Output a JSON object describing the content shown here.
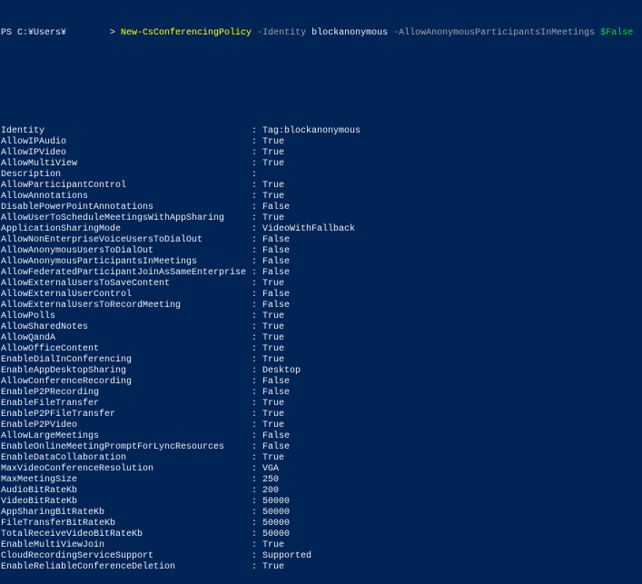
{
  "prompt": {
    "text": "PS C:¥Users¥        > ",
    "command": "New-CsConferencingPolicy",
    "param1": "-Identity",
    "arg1": "blockanonymous",
    "param2": "-AllowAnonymousParticipantsInMeetings",
    "arg2": "$False"
  },
  "output": [
    {
      "key": "Identity",
      "value": "Tag:blockanonymous"
    },
    {
      "key": "AllowIPAudio",
      "value": "True"
    },
    {
      "key": "AllowIPVideo",
      "value": "True"
    },
    {
      "key": "AllowMultiView",
      "value": "True"
    },
    {
      "key": "Description",
      "value": ""
    },
    {
      "key": "AllowParticipantControl",
      "value": "True"
    },
    {
      "key": "AllowAnnotations",
      "value": "True"
    },
    {
      "key": "DisablePowerPointAnnotations",
      "value": "False"
    },
    {
      "key": "AllowUserToScheduleMeetingsWithAppSharing",
      "value": "True"
    },
    {
      "key": "ApplicationSharingMode",
      "value": "VideoWithFallback"
    },
    {
      "key": "AllowNonEnterpriseVoiceUsersToDialOut",
      "value": "False"
    },
    {
      "key": "AllowAnonymousUsersToDialOut",
      "value": "False"
    },
    {
      "key": "AllowAnonymousParticipantsInMeetings",
      "value": "False"
    },
    {
      "key": "AllowFederatedParticipantJoinAsSameEnterprise",
      "value": "False"
    },
    {
      "key": "AllowExternalUsersToSaveContent",
      "value": "True"
    },
    {
      "key": "AllowExternalUserControl",
      "value": "False"
    },
    {
      "key": "AllowExternalUsersToRecordMeeting",
      "value": "False"
    },
    {
      "key": "AllowPolls",
      "value": "True"
    },
    {
      "key": "AllowSharedNotes",
      "value": "True"
    },
    {
      "key": "AllowQandA",
      "value": "True"
    },
    {
      "key": "AllowOfficeContent",
      "value": "True"
    },
    {
      "key": "EnableDialInConferencing",
      "value": "True"
    },
    {
      "key": "EnableAppDesktopSharing",
      "value": "Desktop"
    },
    {
      "key": "AllowConferenceRecording",
      "value": "False"
    },
    {
      "key": "EnableP2PRecording",
      "value": "False"
    },
    {
      "key": "EnableFileTransfer",
      "value": "True"
    },
    {
      "key": "EnableP2PFileTransfer",
      "value": "True"
    },
    {
      "key": "EnableP2PVideo",
      "value": "True"
    },
    {
      "key": "AllowLargeMeetings",
      "value": "False"
    },
    {
      "key": "EnableOnlineMeetingPromptForLyncResources",
      "value": "False"
    },
    {
      "key": "EnableDataCollaboration",
      "value": "True"
    },
    {
      "key": "MaxVideoConferenceResolution",
      "value": "VGA"
    },
    {
      "key": "MaxMeetingSize",
      "value": "250"
    },
    {
      "key": "AudioBitRateKb",
      "value": "200"
    },
    {
      "key": "VideoBitRateKb",
      "value": "50000"
    },
    {
      "key": "AppSharingBitRateKb",
      "value": "50000"
    },
    {
      "key": "FileTransferBitRateKb",
      "value": "50000"
    },
    {
      "key": "TotalReceiveVideoBitRateKb",
      "value": "50000"
    },
    {
      "key": "EnableMultiViewJoin",
      "value": "True"
    },
    {
      "key": "CloudRecordingServiceSupport",
      "value": "Supported"
    },
    {
      "key": "EnableReliableConferenceDeletion",
      "value": "True"
    }
  ],
  "colors": {
    "background": "#012456",
    "text": "#eeedf0",
    "command": "#ffff00",
    "parameter": "#a0a0a0",
    "variable": "#13e013"
  }
}
